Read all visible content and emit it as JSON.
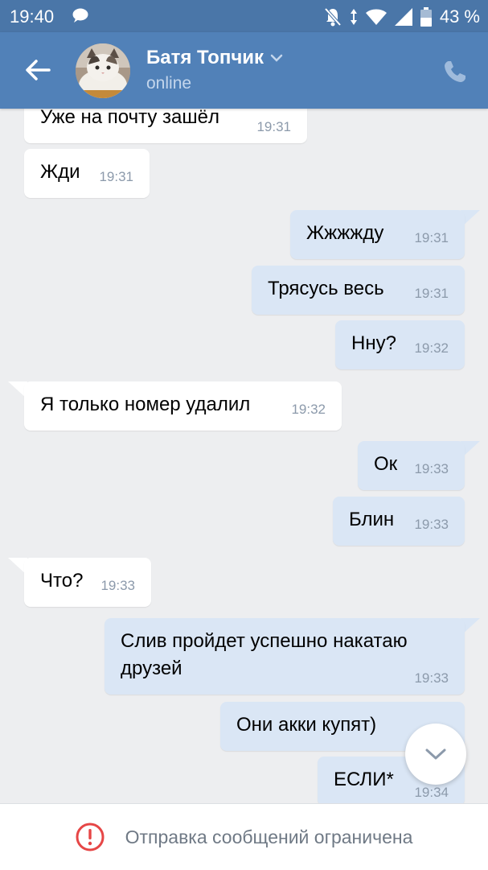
{
  "status_bar": {
    "time": "19:40",
    "battery": "43 %"
  },
  "header": {
    "contact_name": "Батя Топчик",
    "status": "online"
  },
  "messages": [
    {
      "dir": "in",
      "text": "Уже на почту зашёл",
      "time": "19:31"
    },
    {
      "dir": "in",
      "text": "Жди",
      "time": "19:31"
    },
    {
      "dir": "out",
      "text": "Жжжжду",
      "time": "19:31"
    },
    {
      "dir": "out",
      "text": "Трясусь весь",
      "time": "19:31"
    },
    {
      "dir": "out",
      "text": "Нну?",
      "time": "19:32"
    },
    {
      "dir": "in",
      "text": "Я только номер удалил",
      "time": "19:32"
    },
    {
      "dir": "out",
      "text": "Ок",
      "time": "19:33"
    },
    {
      "dir": "out",
      "text": "Блин",
      "time": "19:33"
    },
    {
      "dir": "in",
      "text": "Что?",
      "time": "19:33"
    },
    {
      "dir": "out",
      "text": "Слив пройдет успешно накатаю друзей",
      "time": "19:33"
    },
    {
      "dir": "out",
      "text": "Они акки купят)",
      "time": ""
    },
    {
      "dir": "out",
      "text": "ЕСЛИ*",
      "time": "19:34"
    }
  ],
  "bottom_bar": {
    "notice": "Отправка сообщений ограничена"
  },
  "colors": {
    "header": "#5181b8",
    "status_bar": "#4a76a8",
    "background": "#edeef0",
    "incoming_bubble": "#ffffff",
    "outgoing_bubble": "#dae6f5",
    "warning": "#e64646"
  },
  "icons": {
    "back": "arrow-left-icon",
    "phone": "phone-icon",
    "scroll_down": "chevron-down-icon",
    "warning": "exclamation-circle-icon"
  }
}
